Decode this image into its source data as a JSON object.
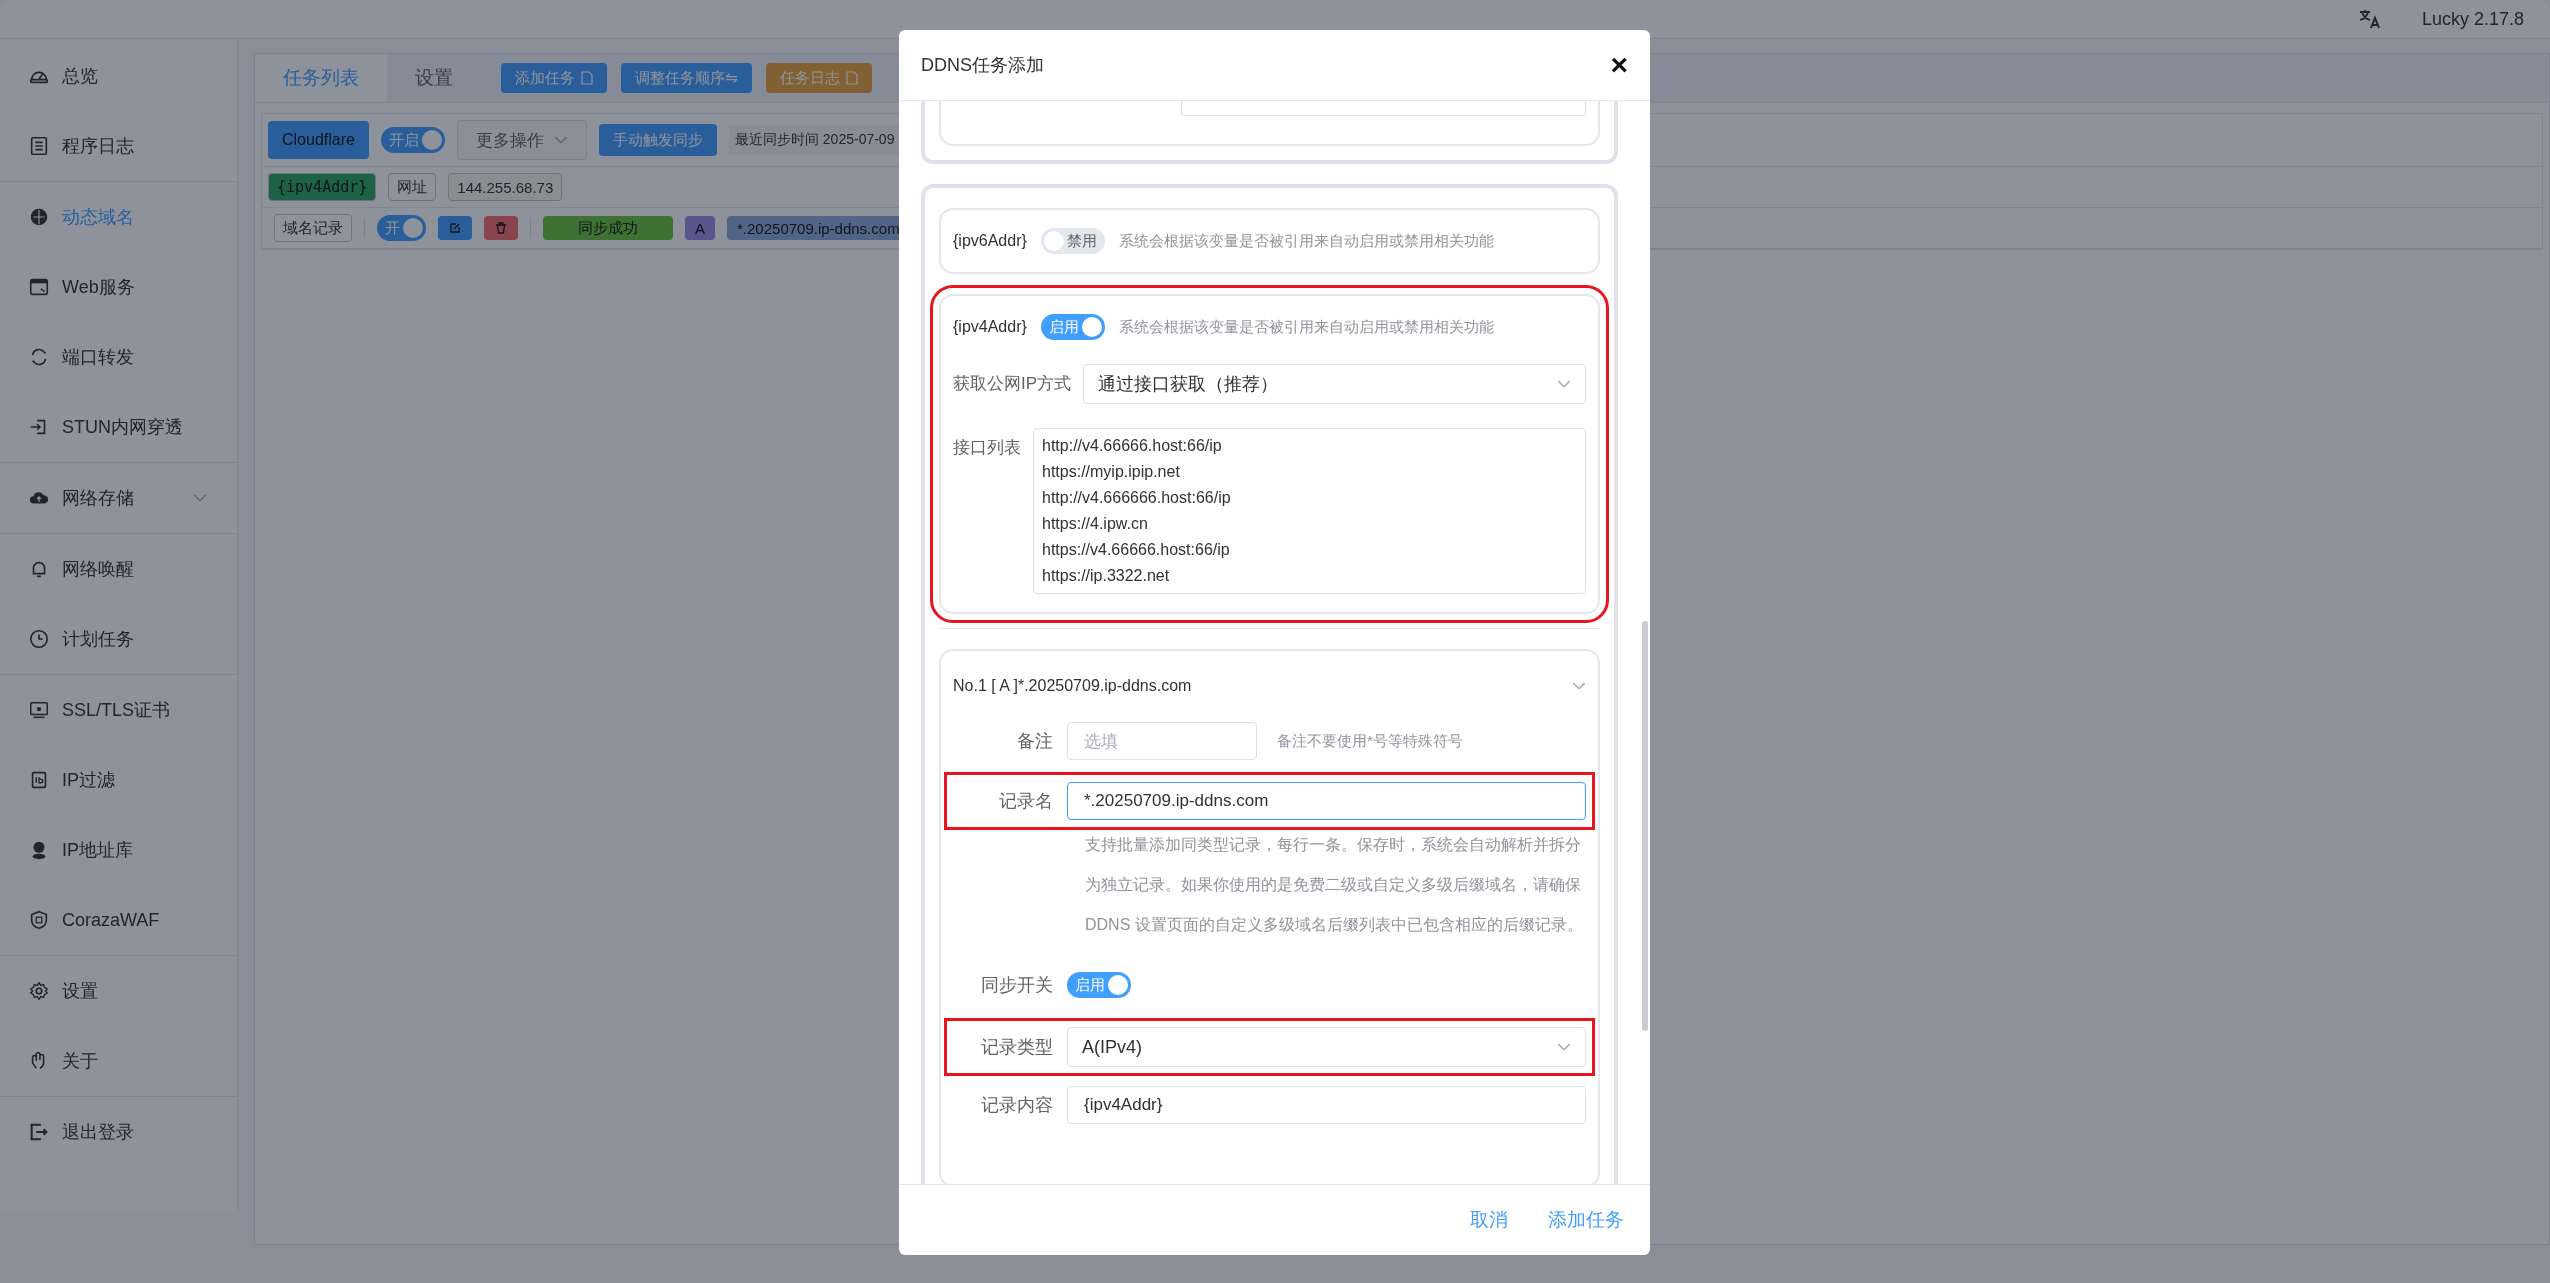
{
  "topbar": {
    "version": "Lucky 2.17.8"
  },
  "sidebar": {
    "groups": [
      {
        "items": [
          {
            "label": "总览",
            "kind": "link",
            "selected": false
          },
          {
            "label": "程序日志",
            "kind": "link",
            "selected": false
          }
        ]
      },
      {
        "items": [
          {
            "label": "动态域名",
            "kind": "link",
            "selected": true
          },
          {
            "label": "Web服务",
            "kind": "link",
            "selected": false
          },
          {
            "label": "端口转发",
            "kind": "link",
            "selected": false
          },
          {
            "label": "STUN内网穿透",
            "kind": "link",
            "selected": false
          }
        ]
      },
      {
        "items": [
          {
            "label": "网络存储",
            "kind": "submenu",
            "selected": false
          }
        ]
      },
      {
        "items": [
          {
            "label": "网络唤醒",
            "kind": "link",
            "selected": false
          },
          {
            "label": "计划任务",
            "kind": "link",
            "selected": false
          }
        ]
      },
      {
        "items": [
          {
            "label": "SSL/TLS证书",
            "kind": "link",
            "selected": false
          },
          {
            "label": "IP过滤",
            "kind": "link",
            "selected": false
          },
          {
            "label": "IP地址库",
            "kind": "link",
            "selected": false
          },
          {
            "label": "CorazaWAF",
            "kind": "link",
            "selected": false
          }
        ]
      },
      {
        "items": [
          {
            "label": "设置",
            "kind": "link",
            "selected": false
          },
          {
            "label": "关于",
            "kind": "link",
            "selected": false
          }
        ]
      },
      {
        "items": [
          {
            "label": "退出登录",
            "kind": "link",
            "selected": false
          }
        ]
      }
    ]
  },
  "tabs": [
    {
      "label": "任务列表",
      "selected": true
    },
    {
      "label": "设置",
      "selected": false
    }
  ],
  "toolbar_buttons": [
    {
      "label": "添加任务",
      "kind": "primary"
    },
    {
      "label": "调整任务顺序⇋",
      "kind": "primary"
    },
    {
      "label": "任务日志",
      "kind": "warning"
    }
  ],
  "task": {
    "provider": "Cloudflare",
    "toggle_label": "开启",
    "enabled": true,
    "more": "更多操作",
    "sync_button": "手动触发同步",
    "last_sync": "最近同步时间 2025-07-09",
    "vars": [
      {
        "text": "{ipv4Addr}",
        "kind": "variable"
      },
      {
        "text": "网址",
        "kind": "label"
      },
      {
        "text": "144.255.68.73",
        "kind": "value"
      }
    ],
    "records": [
      {
        "tag": "域名记录",
        "toggle_label": "开",
        "enabled": true,
        "status": "同步成功",
        "type": "A",
        "domain": "*.20250709.ip-ddns.com"
      }
    ]
  },
  "dialog": {
    "title": "DDNS任务添加",
    "close": "×",
    "variables": [
      {
        "name": "{ipv6Addr}",
        "toggle_label": "禁用",
        "enabled": false,
        "hint": "系统会根据该变量是否被引用来自动启用或禁用相关功能",
        "highlighted": false
      },
      {
        "name": "{ipv4Addr}",
        "toggle_label": "启用",
        "enabled": true,
        "hint": "系统会根据该变量是否被引用来自动启用或禁用相关功能",
        "highlighted": true,
        "ip_method": {
          "label": "获取公网IP方式",
          "value": "通过接口获取（推荐）"
        },
        "api_list": {
          "label": "接口列表",
          "lines": [
            "http://v4.66666.host:66/ip",
            "https://myip.ipip.net",
            "http://v4.666666.host:66/ip",
            "https://4.ipw.cn",
            "https://v4.66666.host:66/ip",
            "https://ip.3322.net"
          ]
        }
      }
    ],
    "record": {
      "header": "No.1 [ A ]*.20250709.ip-ddns.com",
      "note": {
        "label": "备注",
        "placeholder": "选填",
        "hint": "备注不要使用*号等特殊符号"
      },
      "name": {
        "label": "记录名",
        "value": "*.20250709.ip-ddns.com",
        "highlighted": true,
        "help": "支持批量添加同类型记录，每行一条。保存时，系统会自动解析并拆分为独立记录。如果你使用的是免费二级或自定义多级后缀域名，请确保DDNS 设置页面的自定义多级域名后缀列表中已包含相应的后缀记录。"
      },
      "sync": {
        "label": "同步开关",
        "toggle_label": "启用",
        "enabled": true
      },
      "type": {
        "label": "记录类型",
        "value": "A(IPv4)",
        "highlighted": true
      },
      "content": {
        "label": "记录内容",
        "value": "{ipv4Addr}"
      }
    },
    "footer": {
      "cancel": "取消",
      "confirm": "添加任务"
    }
  }
}
